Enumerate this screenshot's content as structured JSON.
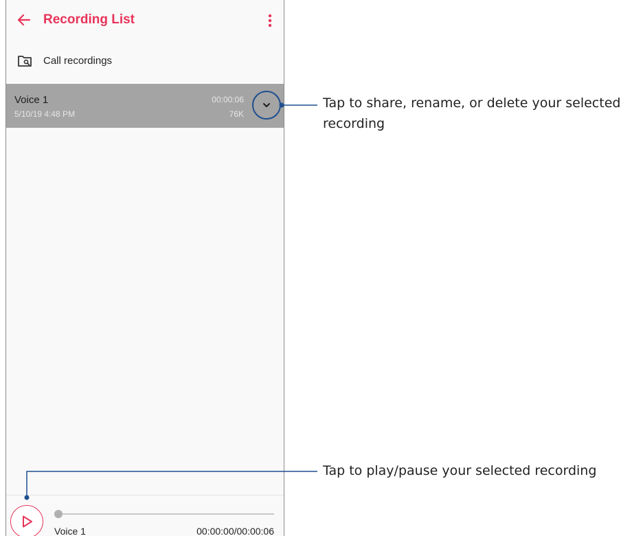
{
  "app": {
    "title": "Recording List",
    "colors": {
      "accent": "#e8345a",
      "callout": "#1e4f8f",
      "selected_row": "#a4a4a4"
    }
  },
  "folder": {
    "label": "Call recordings",
    "icon": "folder-search-icon"
  },
  "recordings": [
    {
      "name": "Voice 1",
      "date": "5/10/19 4:48 PM",
      "duration": "00:00:06",
      "size": "76K",
      "selected": true
    }
  ],
  "player": {
    "track_name": "Voice 1",
    "time": "00:00:00/00:00:06",
    "progress": 0
  },
  "callouts": {
    "expand": "Tap to share, rename, or delete your selected recording",
    "play": "Tap to play/pause your selected recording"
  }
}
